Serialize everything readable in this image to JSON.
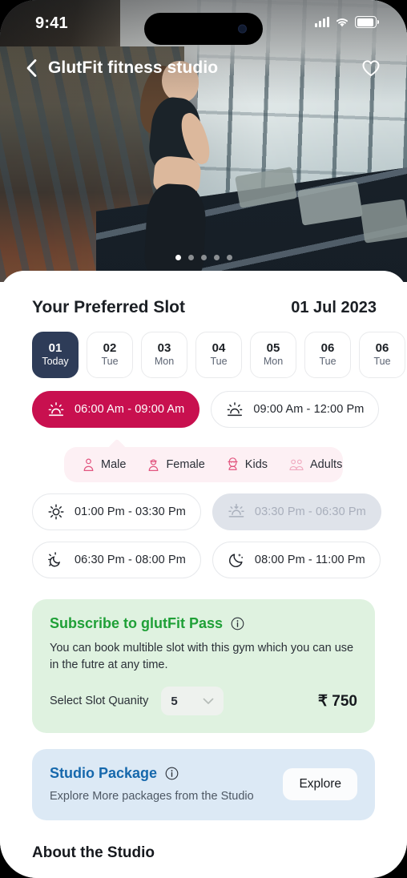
{
  "status_bar": {
    "time": "9:41",
    "signal_icon": "signal-bars-icon",
    "wifi_icon": "wifi-icon",
    "battery_icon": "battery-icon"
  },
  "nav": {
    "back_icon": "chevron-left-icon",
    "title": "GlutFit fitness studio",
    "favorite_icon": "heart-icon"
  },
  "hero": {
    "carousel_dots": 5,
    "active_dot": 1
  },
  "section": {
    "title": "Your Preferred Slot",
    "date": "01 Jul 2023"
  },
  "dates": [
    {
      "day": "01",
      "dow": "Today",
      "selected": true
    },
    {
      "day": "02",
      "dow": "Tue",
      "selected": false
    },
    {
      "day": "03",
      "dow": "Mon",
      "selected": false
    },
    {
      "day": "04",
      "dow": "Tue",
      "selected": false
    },
    {
      "day": "05",
      "dow": "Mon",
      "selected": false
    },
    {
      "day": "06",
      "dow": "Tue",
      "selected": false
    },
    {
      "day": "06",
      "dow": "Tue",
      "selected": false
    }
  ],
  "slots": [
    {
      "label": "06:00 Am - 09:00 Am",
      "icon": "sunrise-icon",
      "state": "selected"
    },
    {
      "label": "09:00 Am - 12:00 Pm",
      "icon": "sunrise-icon",
      "state": "default"
    },
    {
      "label": "01:00 Pm - 03:30 Pm",
      "icon": "sun-icon",
      "state": "default"
    },
    {
      "label": "03:30 Pm - 06:30 Pm",
      "icon": "sunset-icon",
      "state": "disabled"
    },
    {
      "label": "06:30 Pm - 08:00 Pm",
      "icon": "moon-sun-icon",
      "state": "default"
    },
    {
      "label": "08:00 Pm - 11:00 Pm",
      "icon": "moon-stars-icon",
      "state": "default"
    }
  ],
  "audience": [
    {
      "label": "Male",
      "icon": "male-icon"
    },
    {
      "label": "Female",
      "icon": "female-icon"
    },
    {
      "label": "Kids",
      "icon": "kids-icon"
    },
    {
      "label": "Adults",
      "icon": "adults-icon"
    }
  ],
  "pass_card": {
    "title": "Subscribe to glutFit Pass",
    "info_icon": "info-icon",
    "description": "You can book multible slot with this gym which you can use in the futre at any time.",
    "qty_label": "Select Slot Quanity",
    "qty_value": "5",
    "dropdown_icon": "chevron-down-icon",
    "price": "₹ 750"
  },
  "package_card": {
    "title": "Studio Package",
    "info_icon": "info-icon",
    "description": "Explore More packages from the Studio",
    "button_label": "Explore"
  },
  "about": {
    "title": "About the Studio"
  },
  "colors": {
    "accent_crimson": "#c8104f",
    "navy_chip": "#2e3c58",
    "green_title": "#1fa037",
    "green_card_bg": "#dff2e0",
    "blue_title": "#1668ac",
    "blue_card_bg": "#dce9f5",
    "pink_strip_bg": "#fdf0f4",
    "pink_icon": "#e2557f",
    "disabled_bg": "#dfe3ea"
  }
}
